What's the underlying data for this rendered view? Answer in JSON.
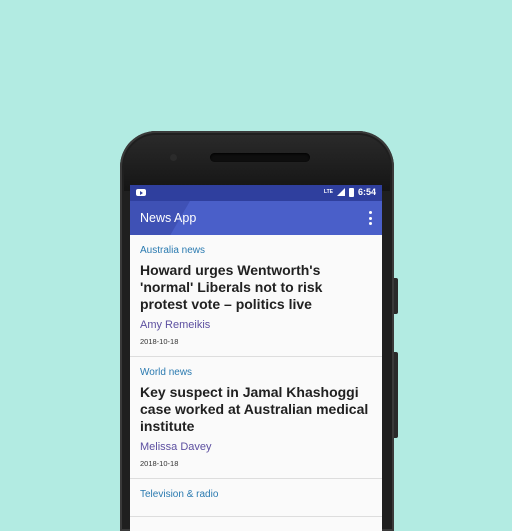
{
  "app": {
    "title": "News App"
  },
  "statusbar": {
    "network": "LTE",
    "time": "6:54"
  },
  "articles": [
    {
      "section": "Australia news",
      "headline": "Howard urges Wentworth's 'normal' Liberals not to risk protest vote  – politics live",
      "author": "Amy Remeikis",
      "date": "2018-10-18"
    },
    {
      "section": "World news",
      "headline": "Key suspect in Jamal Khashoggi case worked at Australian medical institute",
      "author": "Melissa Davey",
      "date": "2018-10-18"
    },
    {
      "section": "Television & radio",
      "headline": "",
      "author": "",
      "date": ""
    }
  ]
}
